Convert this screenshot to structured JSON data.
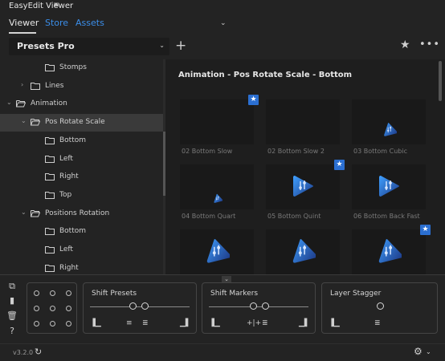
{
  "app": {
    "title": "EasyEdit Viewer",
    "menu_icon": "hamburger-icon"
  },
  "tabs": [
    {
      "label": "Viewer",
      "active": true
    },
    {
      "label": "Store",
      "active": false
    },
    {
      "label": "Assets",
      "active": false
    }
  ],
  "preset_select": {
    "value": "Presets Pro"
  },
  "tree": [
    {
      "label": "Stomps",
      "level": 2,
      "expanded": false,
      "selected": false
    },
    {
      "label": "Lines",
      "level": 1,
      "expanded": false,
      "selected": false
    },
    {
      "label": "Animation",
      "level": 0,
      "expanded": true,
      "selected": false
    },
    {
      "label": "Pos Rotate Scale",
      "level": 1,
      "expanded": true,
      "selected": true
    },
    {
      "label": "Bottom",
      "level": 2,
      "expanded": false,
      "selected": false
    },
    {
      "label": "Left",
      "level": 2,
      "expanded": false,
      "selected": false
    },
    {
      "label": "Right",
      "level": 2,
      "expanded": false,
      "selected": false
    },
    {
      "label": "Top",
      "level": 2,
      "expanded": false,
      "selected": false
    },
    {
      "label": "Positions Rotation",
      "level": 1,
      "expanded": true,
      "selected": false
    },
    {
      "label": "Bottom",
      "level": 2,
      "expanded": false,
      "selected": false
    },
    {
      "label": "Left",
      "level": 2,
      "expanded": false,
      "selected": false
    },
    {
      "label": "Right",
      "level": 2,
      "expanded": false,
      "selected": false
    }
  ],
  "grid": {
    "title": "Animation - Pos Rotate Scale - Bottom",
    "tiles": [
      {
        "name": "02 Bottom Slow",
        "starred": true,
        "icon": "none"
      },
      {
        "name": "02 Bottom Slow 2",
        "starred": false,
        "icon": "none"
      },
      {
        "name": "03 Bottom Cubic",
        "starred": false,
        "icon": "small"
      },
      {
        "name": "04 Bottom Quart",
        "starred": false,
        "icon": "tiny"
      },
      {
        "name": "05 Bottom Quint",
        "starred": true,
        "icon": "play"
      },
      {
        "name": "06 Bottom Back Fast",
        "starred": false,
        "icon": "play"
      },
      {
        "name": "",
        "starred": false,
        "icon": "tri"
      },
      {
        "name": "",
        "starred": false,
        "icon": "tri"
      },
      {
        "name": "",
        "starred": true,
        "icon": "tri"
      }
    ]
  },
  "cards": {
    "shift_presets": "Shift Presets",
    "shift_markers": "Shift Markers",
    "layer_stagger": "Layer Stagger"
  },
  "footer": {
    "version": "v3.2.0"
  },
  "colors": {
    "accent": "#3b8ee9",
    "star_badge": "#2b6fd1",
    "bg": "#232323"
  }
}
